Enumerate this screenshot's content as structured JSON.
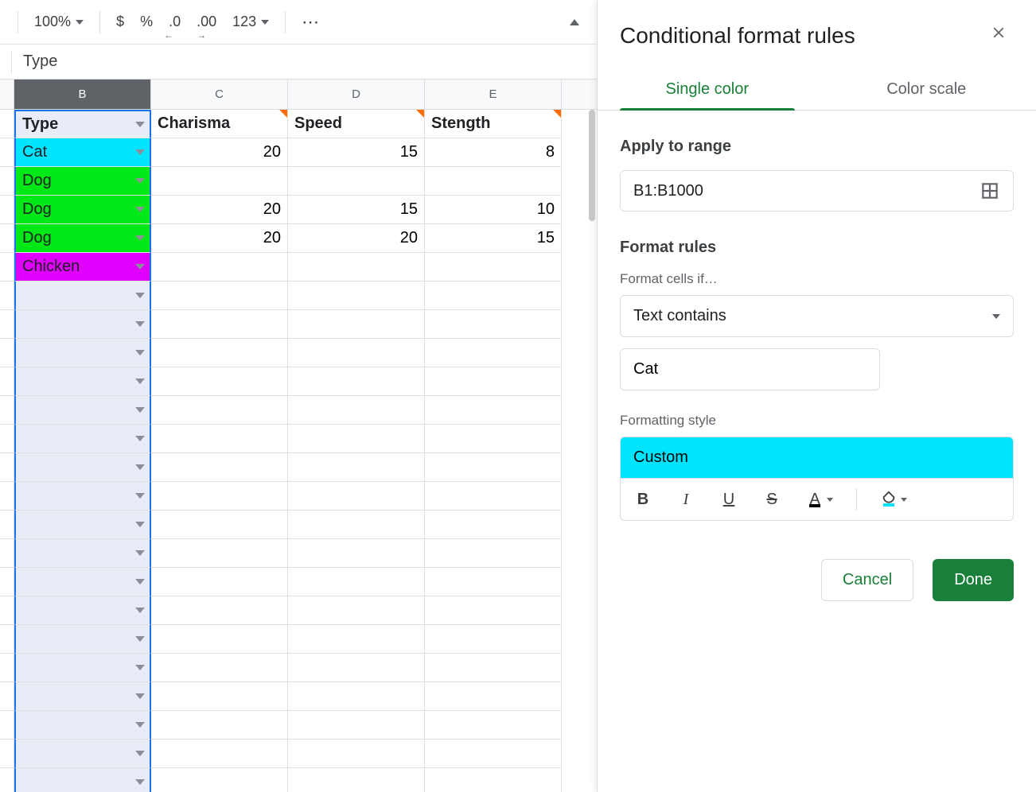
{
  "toolbar": {
    "zoom": "100%",
    "fmt_123": "123"
  },
  "formula_bar": {
    "value": "Type"
  },
  "columns": [
    "B",
    "C",
    "D",
    "E"
  ],
  "headers": {
    "B": "Type",
    "C": "Charisma",
    "D": "Speed",
    "E": "Stength"
  },
  "rows": [
    {
      "type": "Cat",
      "c": "20",
      "d": "15",
      "e": "8",
      "bg": "#00e5ff"
    },
    {
      "type": "Dog",
      "c": "",
      "d": "",
      "e": "",
      "bg": "#00e816"
    },
    {
      "type": "Dog",
      "c": "20",
      "d": "15",
      "e": "10",
      "bg": "#00e816"
    },
    {
      "type": "Dog",
      "c": "20",
      "d": "20",
      "e": "15",
      "bg": "#00e816"
    },
    {
      "type": "Chicken",
      "c": "",
      "d": "",
      "e": "",
      "bg": "#e000ff"
    }
  ],
  "sidepanel": {
    "title": "Conditional format rules",
    "tabs": {
      "single": "Single color",
      "scale": "Color scale"
    },
    "apply_to_range_label": "Apply to range",
    "range_value": "B1:B1000",
    "format_rules_label": "Format rules",
    "format_cells_if_label": "Format cells if…",
    "condition_value": "Text contains",
    "text_value": "Cat",
    "formatting_style_label": "Formatting style",
    "style_name": "Custom",
    "cancel": "Cancel",
    "done": "Done"
  }
}
